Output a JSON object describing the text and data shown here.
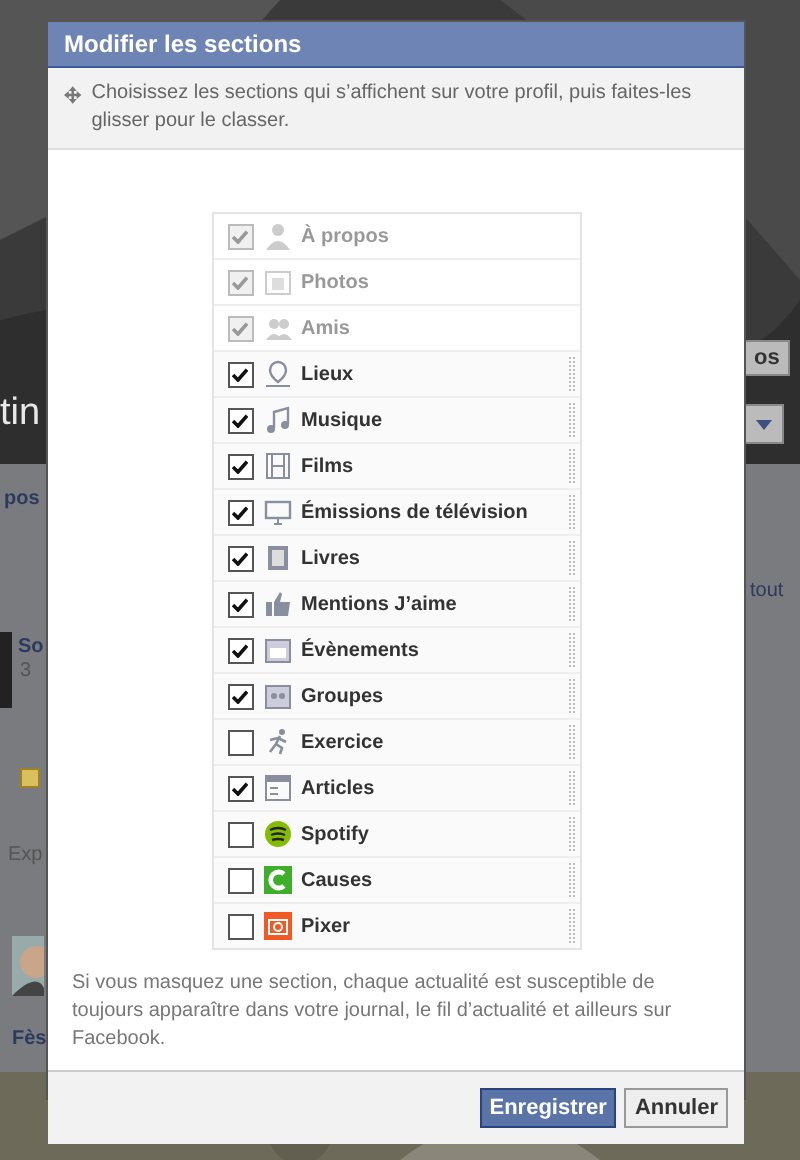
{
  "background": {
    "profile_name": "tin",
    "cover_button": "os",
    "nav_link": "pos",
    "see_all_link": "tout",
    "post_author": "So",
    "post_time": "3",
    "section_label": "Exp",
    "friend_name": "Fès"
  },
  "dialog": {
    "title": "Modifier les sections",
    "instructions": "Choisissez les sections qui s’affichent sur votre profil, puis faites-les glisser pour le classer.",
    "sections": [
      {
        "label": "À propos",
        "checked": true,
        "disabled": true
      },
      {
        "label": "Photos",
        "checked": true,
        "disabled": true
      },
      {
        "label": "Amis",
        "checked": true,
        "disabled": true
      },
      {
        "label": "Lieux",
        "checked": true,
        "disabled": false
      },
      {
        "label": "Musique",
        "checked": true,
        "disabled": false
      },
      {
        "label": "Films",
        "checked": true,
        "disabled": false
      },
      {
        "label": "Émissions de télévision",
        "checked": true,
        "disabled": false
      },
      {
        "label": "Livres",
        "checked": true,
        "disabled": false
      },
      {
        "label": "Mentions J’aime",
        "checked": true,
        "disabled": false
      },
      {
        "label": "Évènements",
        "checked": true,
        "disabled": false
      },
      {
        "label": "Groupes",
        "checked": true,
        "disabled": false
      },
      {
        "label": "Exercice",
        "checked": false,
        "disabled": false
      },
      {
        "label": "Articles",
        "checked": true,
        "disabled": false
      },
      {
        "label": "Spotify",
        "checked": false,
        "disabled": false
      },
      {
        "label": "Causes",
        "checked": false,
        "disabled": false
      },
      {
        "label": "Pixer",
        "checked": false,
        "disabled": false
      }
    ],
    "note": "Si vous masquez une section, chaque actualité est susceptible de toujours apparaître dans votre journal, le fil d’actualité et ailleurs sur Facebook.",
    "buttons": [
      {
        "label": "Enregistrer",
        "kind": "primary"
      },
      {
        "label": "Annuler",
        "kind": "secondary"
      }
    ]
  }
}
